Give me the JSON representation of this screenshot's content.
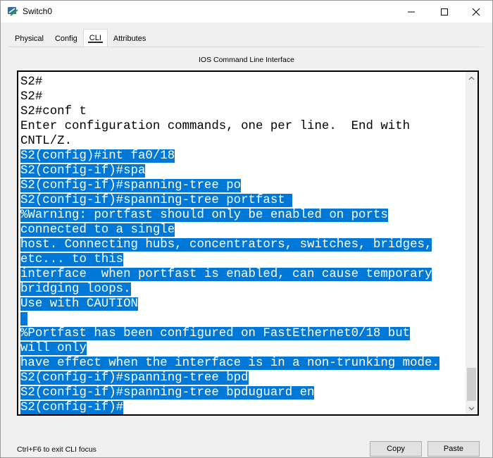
{
  "window": {
    "title": "Switch0"
  },
  "tabs": [
    {
      "label": "Physical",
      "active": false
    },
    {
      "label": "Config",
      "active": false
    },
    {
      "label": "CLI",
      "active": true
    },
    {
      "label": "Attributes",
      "active": false
    }
  ],
  "cli": {
    "panel_title": "IOS Command Line Interface",
    "lines": [
      {
        "text": "S2#",
        "selected": false
      },
      {
        "text": "S2#",
        "selected": false
      },
      {
        "text": "S2#conf t",
        "selected": false
      },
      {
        "text": "Enter configuration commands, one per line.  End with",
        "selected": false
      },
      {
        "text": "CNTL/Z.",
        "selected": false
      },
      {
        "text": "S2(config)#int fa0/18",
        "selected": true
      },
      {
        "text": "S2(config-if)#spa",
        "selected": true
      },
      {
        "text": "S2(config-if)#spanning-tree po",
        "selected": true
      },
      {
        "text": "S2(config-if)#spanning-tree portfast ",
        "selected": true
      },
      {
        "text": "%Warning: portfast should only be enabled on ports",
        "selected": true
      },
      {
        "text": "connected to a single",
        "selected": true
      },
      {
        "text": "host. Connecting hubs, concentrators, switches, bridges,",
        "selected": true
      },
      {
        "text": "etc... to this",
        "selected": true
      },
      {
        "text": "interface  when portfast is enabled, can cause temporary",
        "selected": true
      },
      {
        "text": "bridging loops.",
        "selected": true
      },
      {
        "text": "Use with CAUTION",
        "selected": true
      },
      {
        "text": " ",
        "selected": true
      },
      {
        "text": "%Portfast has been configured on FastEthernet0/18 but",
        "selected": true
      },
      {
        "text": "will only",
        "selected": true
      },
      {
        "text": "have effect when the interface is in a non-trunking mode.",
        "selected": true
      },
      {
        "text": "S2(config-if)#spanning-tree bpd",
        "selected": true
      },
      {
        "text": "S2(config-if)#spanning-tree bpduguard en",
        "selected": true
      },
      {
        "text": "S2(config-if)#",
        "selected": true
      }
    ],
    "footer_hint": "Ctrl+F6 to exit CLI focus",
    "copy_label": "Copy",
    "paste_label": "Paste"
  },
  "colors": {
    "selection": "#0078d7",
    "selection_text": "#ffffff"
  },
  "icons": [
    "packet-tracer-switch-icon",
    "minimize-icon",
    "maximize-icon",
    "close-icon",
    "scroll-up-icon",
    "scroll-down-icon"
  ]
}
